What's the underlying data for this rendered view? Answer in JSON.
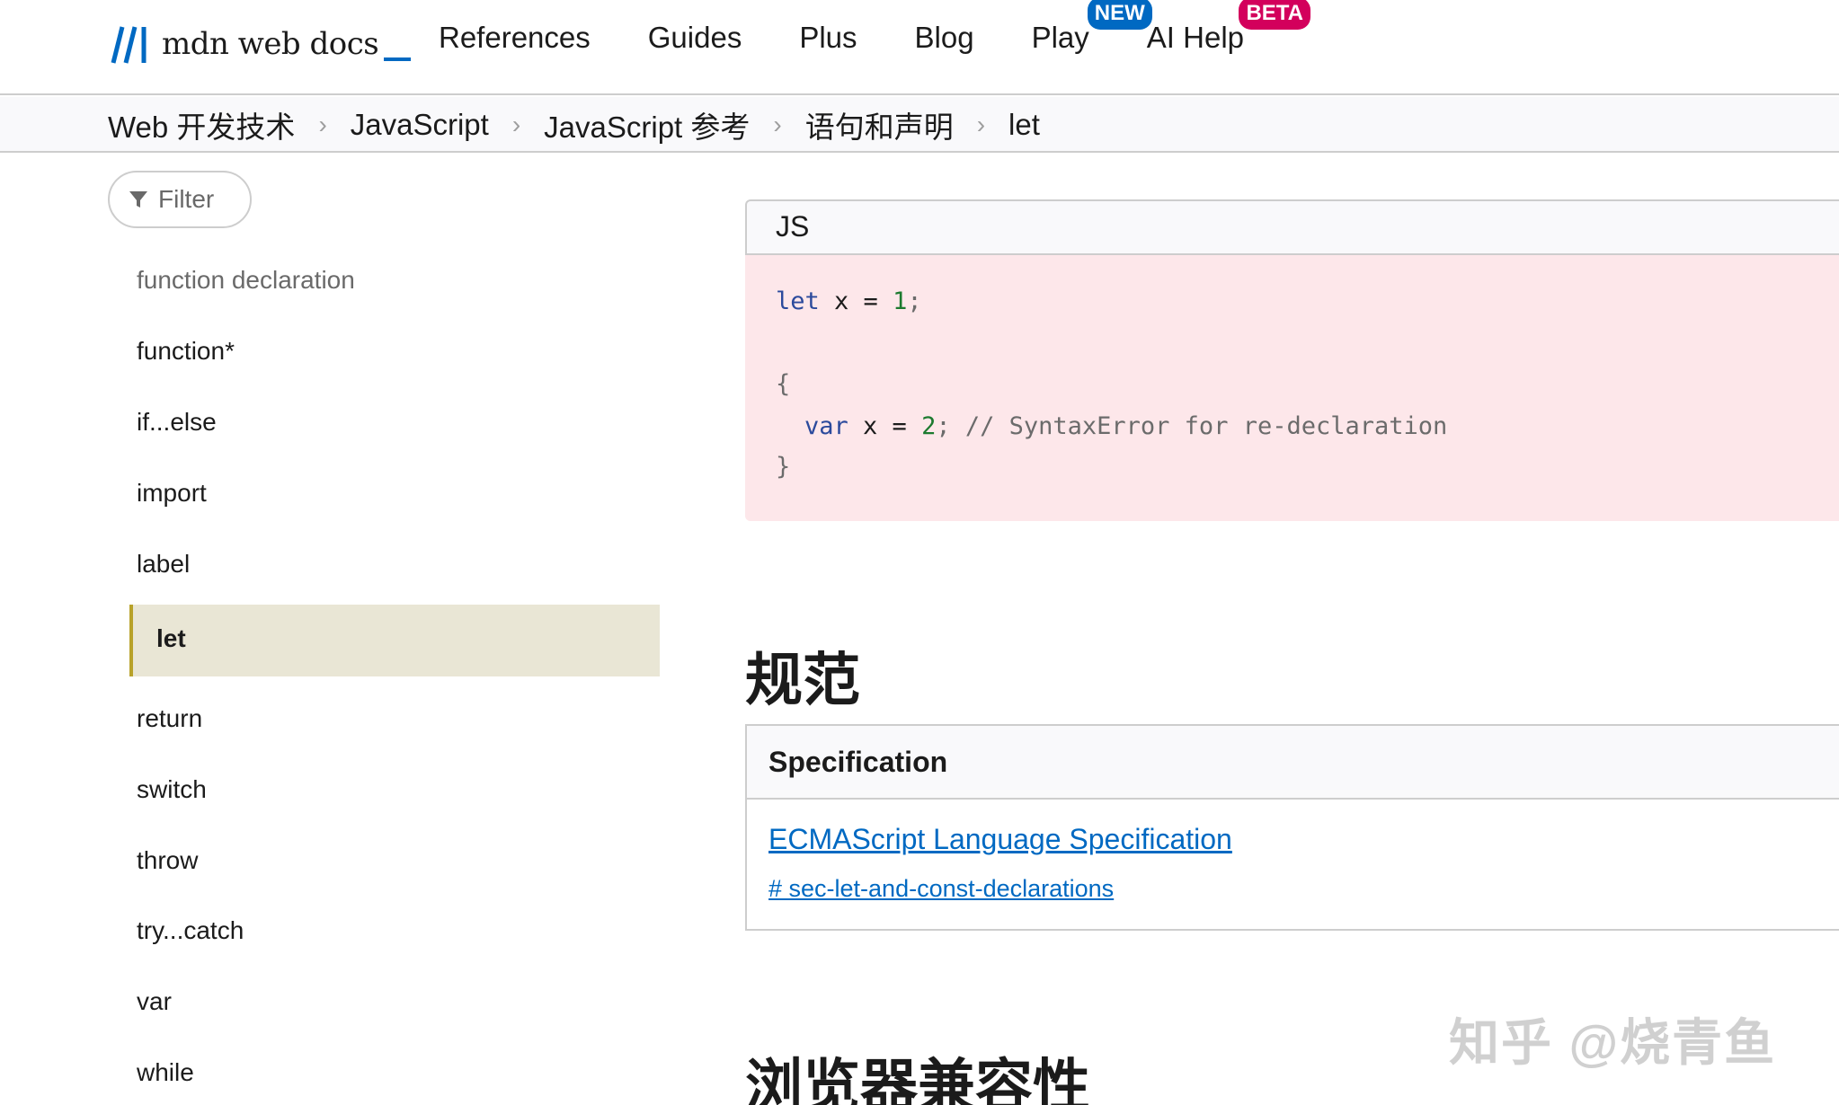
{
  "nav": {
    "logo_text": "mdn web docs",
    "items": [
      {
        "label": "References"
      },
      {
        "label": "Guides"
      },
      {
        "label": "Plus"
      },
      {
        "label": "Blog"
      },
      {
        "label": "Play",
        "badge": "NEW"
      },
      {
        "label": "AI Help",
        "badge": "BETA"
      }
    ],
    "badge_colors": {
      "new": "#0069c2",
      "beta": "#d3005c"
    }
  },
  "breadcrumbs": [
    "Web 开发技术",
    "JavaScript",
    "JavaScript 参考",
    "语句和声明",
    "let"
  ],
  "sidebar": {
    "filter_label": "Filter",
    "items": [
      "function declaration",
      "function*",
      "if...else",
      "import",
      "label",
      "let",
      "return",
      "switch",
      "throw",
      "try...catch",
      "var",
      "while"
    ],
    "active": "let",
    "active_color": "#e9e6d5"
  },
  "code": {
    "language": "JS",
    "lines": {
      "l1": {
        "kw": "let",
        "rest": " x = ",
        "num": "1",
        "end": ";"
      },
      "l2": {
        "brace": "{"
      },
      "l3": {
        "kw": "var",
        "rest": " x = ",
        "num": "2",
        "end": ";",
        "comment": " // SyntaxError for re-declaration"
      },
      "l4": {
        "brace": "}"
      }
    },
    "background": "#fde7ea"
  },
  "spec": {
    "heading": "规范",
    "table_header": "Specification",
    "link_text": "ECMAScript Language Specification",
    "anchor_text": "# sec-let-and-const-declarations"
  },
  "compat": {
    "heading": "浏览器兼容性"
  },
  "watermark": "知乎 @烧青鱼"
}
